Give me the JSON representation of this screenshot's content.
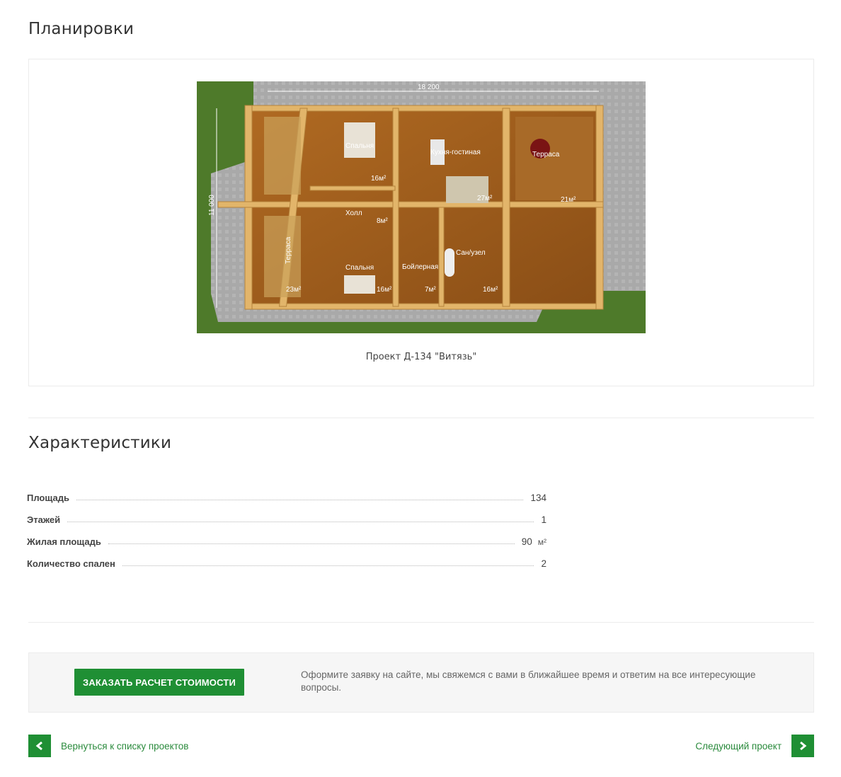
{
  "layouts": {
    "title": "Планировки",
    "caption": "Проект Д-134 \"Витязь\"",
    "plan": {
      "width_label": "18 200",
      "height_label": "11 000",
      "rooms": [
        {
          "name": "Спальня",
          "area": "16м²"
        },
        {
          "name": "Кухня-гостиная",
          "area": "27м²"
        },
        {
          "name": "Терраса",
          "area": "21м²"
        },
        {
          "name": "Холл",
          "area": "8м²"
        },
        {
          "name": "Терраса",
          "area": "23м²"
        },
        {
          "name": "Спальня",
          "area": "16м²"
        },
        {
          "name": "Бойлерная",
          "area": "7м²"
        },
        {
          "name": "Сан/узел",
          "area": "16м²"
        }
      ]
    }
  },
  "characteristics": {
    "title": "Характеристики",
    "rows": [
      {
        "name": "Площадь",
        "value": "134",
        "unit": ""
      },
      {
        "name": "Этажей",
        "value": "1",
        "unit": ""
      },
      {
        "name": "Жилая площадь",
        "value": "90",
        "unit": "м²"
      },
      {
        "name": "Количество спален",
        "value": "2",
        "unit": ""
      }
    ]
  },
  "order": {
    "button_label": "ЗАКАЗАТЬ РАСЧЕТ СТОИМОСТИ",
    "text": "Оформите заявку на сайте, мы свяжемся с вами в ближайшее время и ответим на все интересующие вопросы."
  },
  "nav": {
    "back_label": "Вернуться к списку проектов",
    "next_label": "Следующий проект"
  },
  "colors": {
    "accent": "#1f8f34",
    "link": "#2a8a3c"
  }
}
